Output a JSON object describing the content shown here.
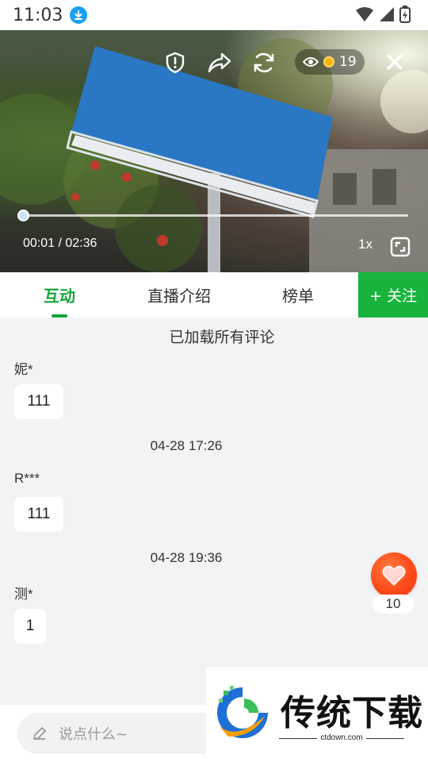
{
  "status_bar": {
    "time": "11:03"
  },
  "video": {
    "viewers": "19",
    "time": "00:01 / 02:36",
    "speed": "1x",
    "progress_fraction": 0.0064
  },
  "tabs": [
    {
      "label": "互动",
      "active": true
    },
    {
      "label": "直播介绍",
      "active": false
    },
    {
      "label": "榜单",
      "active": false
    }
  ],
  "follow_label": "+ 关注",
  "comments": {
    "loaded_note": "已加载所有评论",
    "items": [
      {
        "user": "妮*",
        "text": "111"
      },
      {
        "time": "04-28 17:26"
      },
      {
        "user": "R***",
        "text": "111"
      },
      {
        "time": "04-28 19:36"
      },
      {
        "user": "测*",
        "text": "1"
      }
    ]
  },
  "like": {
    "count": "10"
  },
  "input": {
    "placeholder": "说点什么~"
  },
  "watermark": {
    "title": "传统下载",
    "url": "ctdown.com"
  },
  "colors": {
    "accent": "#16a43a",
    "follow_bg": "#17b33d",
    "like": "#ff4a1a",
    "download_badge": "#1aa0f0"
  }
}
